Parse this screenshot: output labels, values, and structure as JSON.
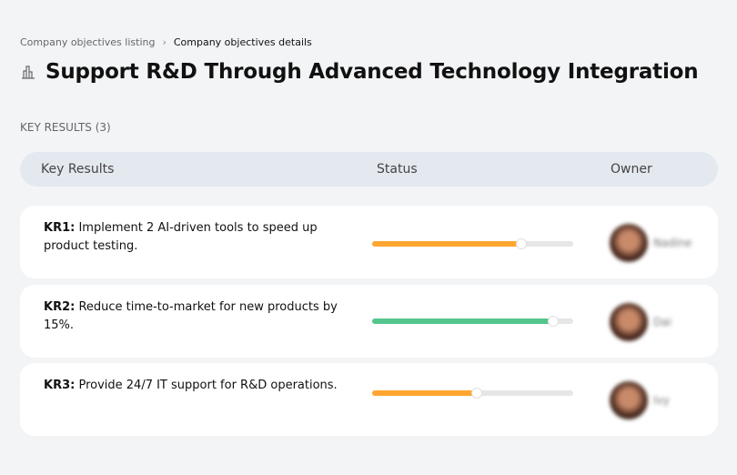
{
  "breadcrumb": {
    "parent": "Company objectives listing",
    "separator": "›",
    "current": "Company objectives details"
  },
  "title": {
    "icon": "building-icon",
    "text": "Support R&D Through Advanced Technology Integration"
  },
  "section_label": "KEY RESULTS (3)",
  "table": {
    "headers": {
      "key_results": "Key Results",
      "status": "Status",
      "owner": "Owner"
    }
  },
  "colors": {
    "orange": "#ffa630",
    "green": "#55c58d",
    "track": "#e6e6e6"
  },
  "rows": [
    {
      "id": "KR1:",
      "text": " Implement 2 AI-driven tools to speed up product testing.",
      "progress_percent": 74,
      "color": "#ffa630",
      "owner": "Nadine"
    },
    {
      "id": "KR2:",
      "text": " Reduce time-to-market for new products by 15%.",
      "progress_percent": 90,
      "color": "#55c58d",
      "owner": "Dai"
    },
    {
      "id": "KR3:",
      "text": " Provide 24/7 IT support for R&D operations.",
      "progress_percent": 52,
      "color": "#ffa630",
      "owner": "Ivy"
    }
  ]
}
